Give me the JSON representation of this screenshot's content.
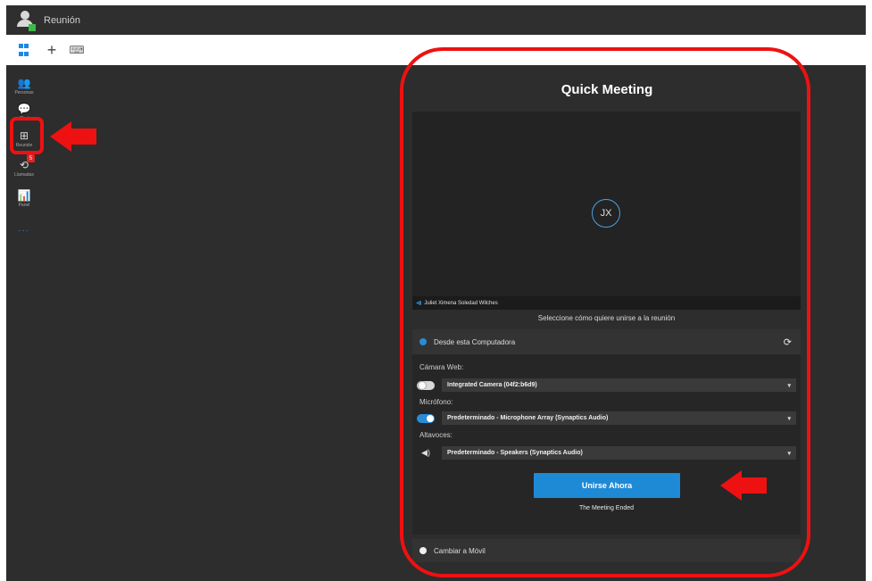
{
  "app": {
    "title": "Reunión"
  },
  "rail": {
    "items": [
      {
        "label": "Personas",
        "glyph": "👥"
      },
      {
        "label": "Chat",
        "glyph": "💬"
      },
      {
        "label": "Reunión",
        "glyph": "⊞"
      },
      {
        "label": "Llamadas",
        "glyph": "⟲",
        "badge": "5"
      },
      {
        "label": "Panel",
        "glyph": "📊"
      }
    ],
    "more": "···"
  },
  "meeting": {
    "title": "Quick Meeting",
    "avatar_initials": "JX",
    "participant_name": "Juliet Ximena Soledad Wilches",
    "join_prompt": "Seleccione cómo quiere unirse a la reunión",
    "computer_option": "Desde esta Computadora",
    "camera_label": "Cámara Web:",
    "camera_device": "Integrated Camera (04f2:b6d9)",
    "mic_label": "Micrófono:",
    "mic_device": "Predeterminado - Microphone Array (Synaptics Audio)",
    "speaker_label": "Altavoces:",
    "speaker_device": "Predeterminado - Speakers (Synaptics Audio)",
    "join_button": "Unirse Ahora",
    "status": "The Meeting Ended",
    "mobile_option": "Cambiar a Móvil"
  },
  "colors": {
    "accent": "#1e8ad6",
    "annotation": "#ee1111",
    "background": "#2d2d2d"
  }
}
